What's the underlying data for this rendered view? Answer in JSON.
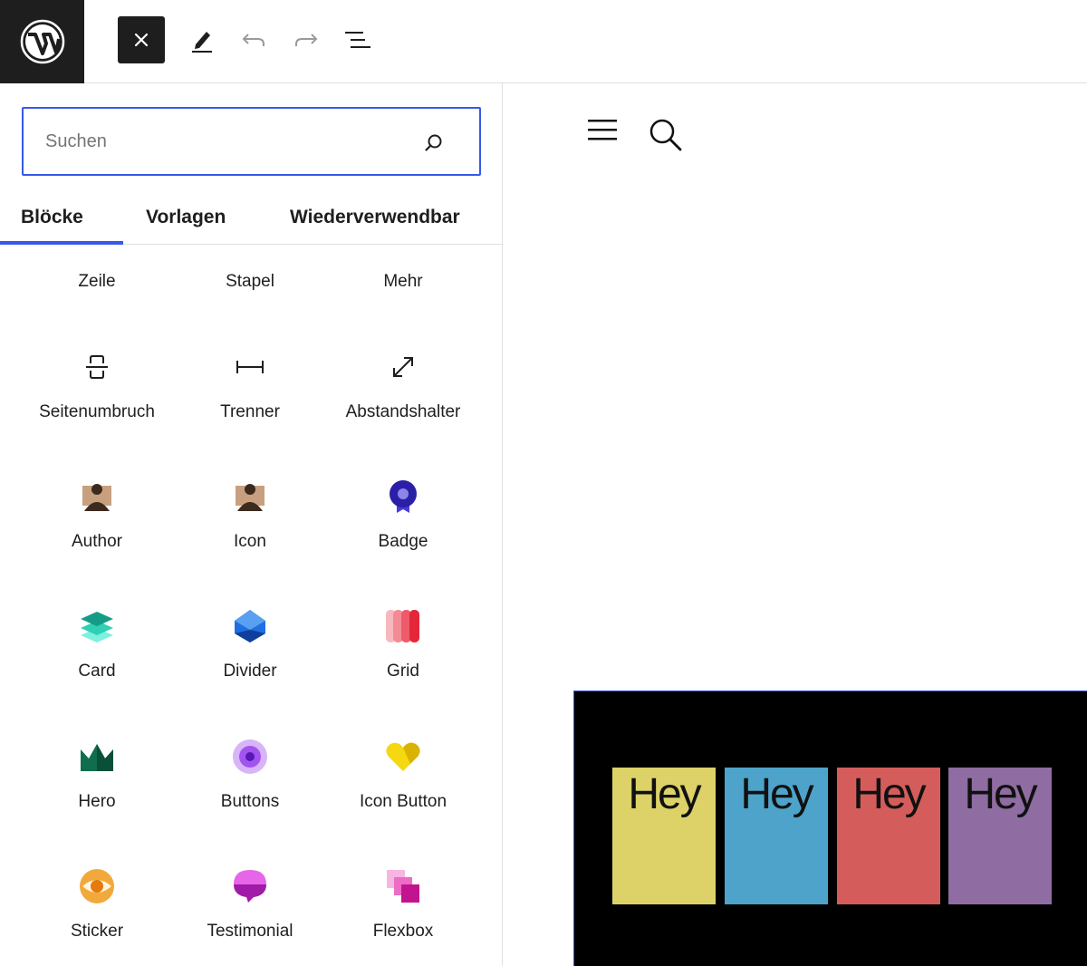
{
  "toolbar": {
    "logo": "wordpress-logo",
    "close_icon": "close-icon",
    "edit_icon": "pencil-icon",
    "undo_icon": "undo-icon",
    "redo_icon": "redo-icon",
    "list_view_icon": "list-view-icon"
  },
  "inserter": {
    "search": {
      "placeholder": "Suchen",
      "value": ""
    },
    "tabs": [
      {
        "label": "Blöcke",
        "active": true
      },
      {
        "label": "Vorlagen",
        "active": false
      },
      {
        "label": "Wiederverwendbar",
        "active": false
      }
    ],
    "blocks": [
      {
        "label": "Zeile",
        "icon": "row-icon"
      },
      {
        "label": "Stapel",
        "icon": "stack-icon"
      },
      {
        "label": "Mehr",
        "icon": "more-icon"
      },
      {
        "label": "Seitenumbruch",
        "icon": "page-break-icon"
      },
      {
        "label": "Trenner",
        "icon": "separator-icon"
      },
      {
        "label": "Abstandshalter",
        "icon": "spacer-icon"
      },
      {
        "label": "Author",
        "icon": "author-icon"
      },
      {
        "label": "Icon",
        "icon": "person-icon"
      },
      {
        "label": "Badge",
        "icon": "badge-icon"
      },
      {
        "label": "Card",
        "icon": "card-layers-icon"
      },
      {
        "label": "Divider",
        "icon": "divider-gem-icon"
      },
      {
        "label": "Grid",
        "icon": "grid-bars-icon"
      },
      {
        "label": "Hero",
        "icon": "hero-crown-icon"
      },
      {
        "label": "Buttons",
        "icon": "buttons-circle-icon"
      },
      {
        "label": "Icon Button",
        "icon": "heart-icon"
      },
      {
        "label": "Sticker",
        "icon": "eye-icon"
      },
      {
        "label": "Testimonial",
        "icon": "speech-bubble-icon"
      },
      {
        "label": "Flexbox",
        "icon": "flexbox-squares-icon"
      }
    ]
  },
  "canvas": {
    "menu_icon": "hamburger-menu-icon",
    "search_icon": "search-icon",
    "cards": [
      {
        "text": "Hey",
        "color": "#dcd268"
      },
      {
        "text": "Hey",
        "color": "#4da3ca"
      },
      {
        "text": "Hey",
        "color": "#d45d5b"
      },
      {
        "text": "Hey",
        "color": "#8f6ca1"
      }
    ]
  },
  "colors": {
    "accent": "#3858e9",
    "dark": "#1e1e1e"
  }
}
